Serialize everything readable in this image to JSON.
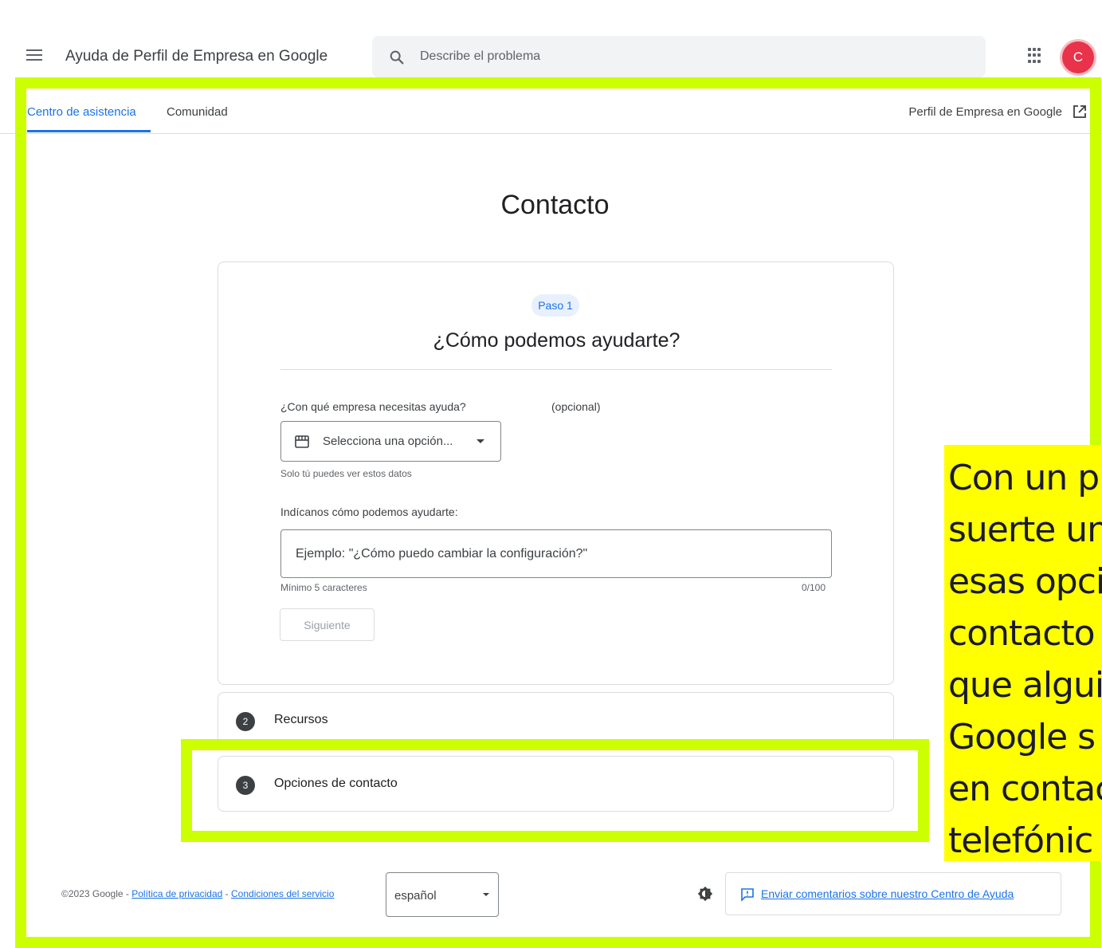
{
  "header": {
    "app_title": "Ayuda de Perfil de Empresa en Google",
    "search_placeholder": "Describe el problema",
    "avatar_letter": "C"
  },
  "nav": {
    "tabs": [
      {
        "label": "Centro de asistencia",
        "active": true
      },
      {
        "label": "Comunidad",
        "active": false
      }
    ],
    "external_link": "Perfil de Empresa en Google"
  },
  "page": {
    "title": "Contacto"
  },
  "step1": {
    "pill": "Paso 1",
    "title": "¿Cómo podemos ayudarte?",
    "business_label": "¿Con qué empresa necesitas ayuda?",
    "optional_label": "(opcional)",
    "business_select_value": "Selecciona una opción...",
    "privacy_hint": "Solo tú puedes ver estos datos",
    "help_label": "Indícanos cómo podemos ayudarte:",
    "help_placeholder": "Ejemplo: \"¿Cómo puedo cambiar la configuración?\"",
    "min_hint": "Mínimo 5 caracteres",
    "counter": "0/100",
    "next_button": "Siguiente"
  },
  "steps": [
    {
      "number": "2",
      "label": "Recursos"
    },
    {
      "number": "3",
      "label": "Opciones de contacto"
    }
  ],
  "footer": {
    "copyright": "©2023 Google",
    "separator": " - ",
    "privacy_link": "Política de privacidad",
    "terms_link": "Condiciones del servicio",
    "language": "español",
    "feedback": "Enviar comentarios sobre nuestro Centro de Ayuda"
  },
  "annotation": {
    "lines": [
      "Con un p",
      "suerte un",
      "esas opci",
      "contacto",
      "que algui",
      "Google s",
      "en contac",
      "telefónic"
    ]
  },
  "colors": {
    "accent": "#1a73e8",
    "highlight": "#ccff00",
    "note_background": "#ffff00",
    "avatar": "#e8334a"
  },
  "icons": [
    "menu-icon",
    "search-icon",
    "apps-grid-icon",
    "external-link-icon",
    "store-icon",
    "chevron-down-icon",
    "theme-icon",
    "feedback-icon"
  ]
}
